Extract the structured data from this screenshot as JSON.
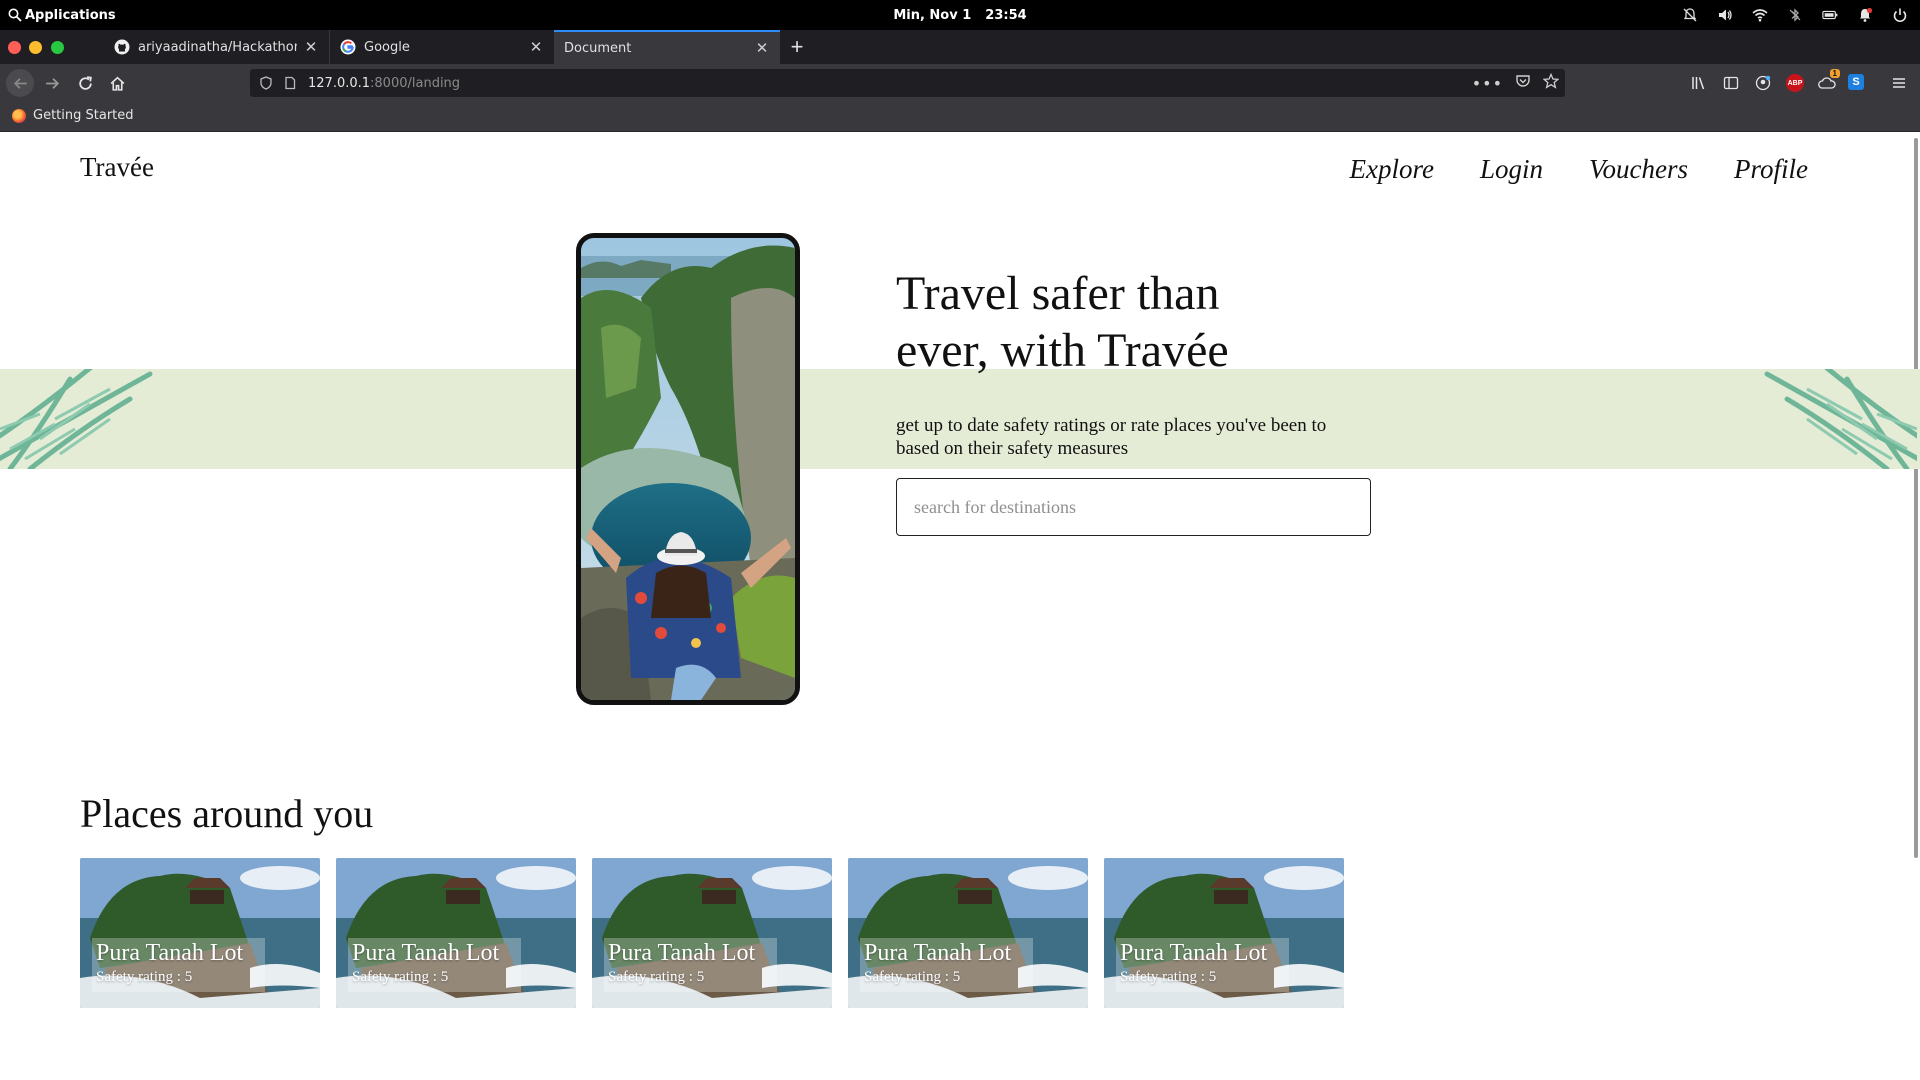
{
  "os": {
    "applications_label": "Applications",
    "date": "Min, Nov 1",
    "time": "23:54"
  },
  "tabs": [
    {
      "title": "ariyaadinatha/Hackathon-Apps",
      "favicon": "github-icon"
    },
    {
      "title": "Google",
      "favicon": "google-icon"
    },
    {
      "title": "Document",
      "favicon": "none"
    }
  ],
  "nav": {
    "url_host": "127.0.0.1",
    "url_path": ":8000/landing"
  },
  "bookmarks": [
    {
      "label": "Getting Started",
      "icon": "firefox-icon"
    }
  ],
  "extensions": {
    "badge": "1",
    "abp": "ABP",
    "s": "S"
  },
  "site": {
    "brand": "Travée",
    "menu": [
      "Explore",
      "Login",
      "Vouchers",
      "Profile"
    ],
    "hero": {
      "title": "Travel safer than ever, with Travée",
      "subtitle": "get up to date safety ratings or rate places you've been to based on their safety measures",
      "search_placeholder": "search for destinations"
    },
    "places_title": "Places around you",
    "places": [
      {
        "name": "Pura Tanah Lot",
        "rating": "Safety rating : 5"
      },
      {
        "name": "Pura Tanah Lot",
        "rating": "Safety rating : 5"
      },
      {
        "name": "Pura Tanah Lot",
        "rating": "Safety rating : 5"
      },
      {
        "name": "Pura Tanah Lot",
        "rating": "Safety rating : 5"
      },
      {
        "name": "Pura Tanah Lot",
        "rating": "Safety rating : 5"
      }
    ]
  },
  "colors": {
    "band": "#e5ecd6",
    "tab_accent": "#2f8cf6",
    "browser_chrome": "#39393d"
  }
}
